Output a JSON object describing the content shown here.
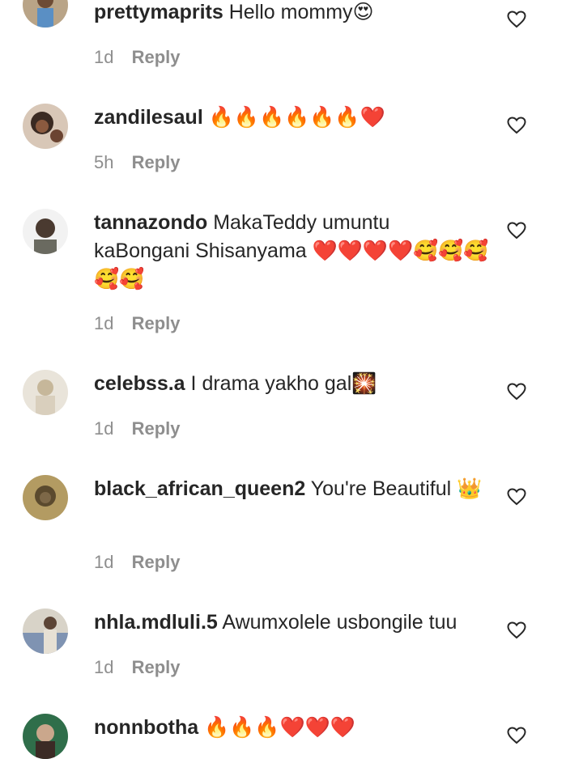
{
  "comments": [
    {
      "username": "prettymaprits",
      "text": "Hello mommy😍",
      "time": "1d",
      "reply": "Reply",
      "avatar_colors": [
        "#b9a487",
        "#5a8fc4"
      ]
    },
    {
      "username": "zandilesaul",
      "text": "🔥🔥🔥🔥🔥🔥❤️",
      "time": "5h",
      "reply": "Reply",
      "avatar_colors": [
        "#3a2a22",
        "#d8c7b7"
      ]
    },
    {
      "username": "tannazondo",
      "text": "MakaTeddy umuntu kaBongani Shisanyama ❤️❤️❤️❤️🥰🥰🥰🥰🥰",
      "time": "1d",
      "reply": "Reply",
      "avatar_colors": [
        "#6a6a60",
        "#f2f2f2"
      ]
    },
    {
      "username": "celebss.a",
      "text": "I drama yakho gal🎇",
      "time": "1d",
      "reply": "Reply",
      "avatar_colors": [
        "#c6b79a",
        "#e9e4da"
      ]
    },
    {
      "username": "black_african_queen2",
      "text": "You're Beautiful 👑",
      "time": "1d",
      "reply": "Reply",
      "avatar_colors": [
        "#5b4a2e",
        "#b39b62"
      ]
    },
    {
      "username": "nhla.mdluli.5",
      "text": "Awumxolele usbongile tuu",
      "time": "1d",
      "reply": "Reply",
      "avatar_colors": [
        "#7f93b2",
        "#d8d3c8"
      ]
    },
    {
      "username": "nonnbotha",
      "text": "🔥🔥🔥❤️❤️❤️",
      "time": "",
      "reply": "",
      "avatar_colors": [
        "#2f6e4a",
        "#caa78c"
      ]
    }
  ]
}
